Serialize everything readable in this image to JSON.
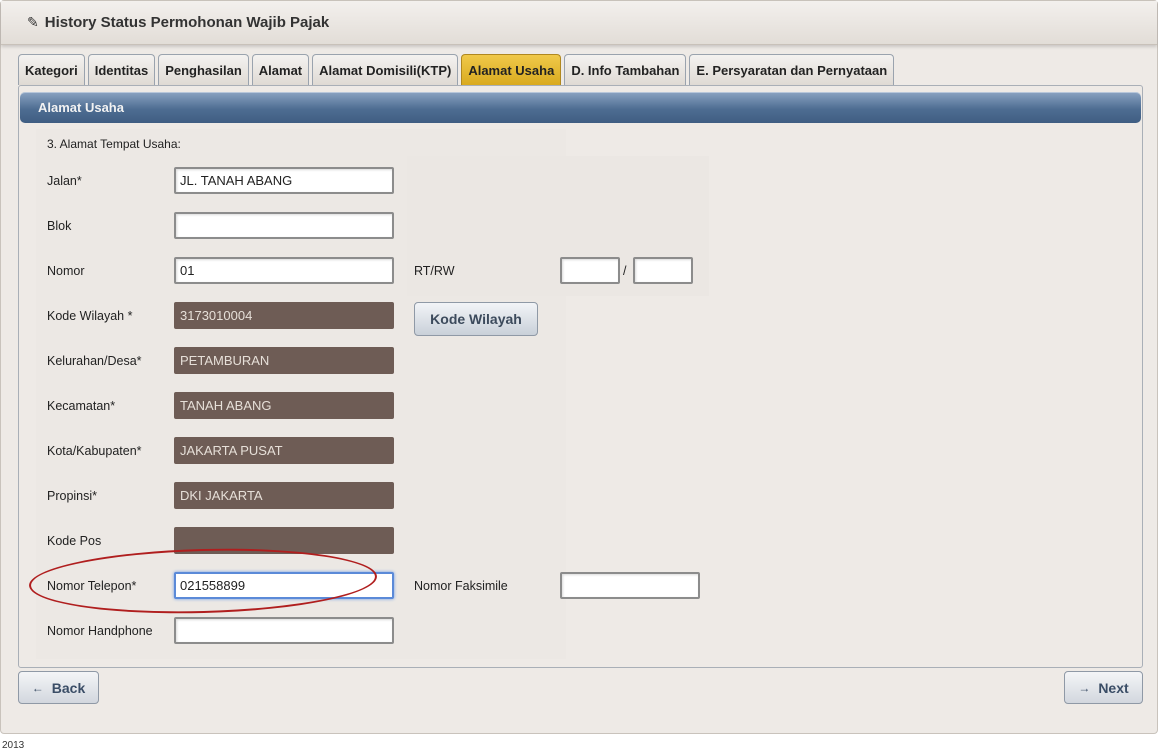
{
  "window": {
    "title": "History Status Permohonan Wajib Pajak",
    "title_icon": "edit-icon"
  },
  "tabs": [
    {
      "label": "Kategori",
      "active": false
    },
    {
      "label": "Identitas",
      "active": false
    },
    {
      "label": "Penghasilan",
      "active": false
    },
    {
      "label": "Alamat",
      "active": false
    },
    {
      "label": "Alamat Domisili(KTP)",
      "active": false
    },
    {
      "label": "Alamat Usaha",
      "active": true
    },
    {
      "label": "D. Info Tambahan",
      "active": false
    },
    {
      "label": "E. Persyaratan dan Pernyataan",
      "active": false
    }
  ],
  "panel": {
    "header": "Alamat Usaha",
    "section_title": "3. Alamat Tempat Usaha:"
  },
  "form": {
    "jalan": {
      "label": "Jalan*",
      "value": "JL. TANAH ABANG"
    },
    "blok": {
      "label": "Blok",
      "value": ""
    },
    "nomor": {
      "label": "Nomor",
      "value": "01"
    },
    "rtrw": {
      "label": "RT/RW",
      "rt": "",
      "rw": "",
      "separator": "/"
    },
    "kode_wilayah": {
      "label": "Kode Wilayah *",
      "value": "3173010004",
      "button": "Kode Wilayah"
    },
    "kelurahan": {
      "label": "Kelurahan/Desa*",
      "value": "PETAMBURAN"
    },
    "kecamatan": {
      "label": "Kecamatan*",
      "value": "TANAH ABANG"
    },
    "kota": {
      "label": "Kota/Kabupaten*",
      "value": "JAKARTA PUSAT"
    },
    "propinsi": {
      "label": "Propinsi*",
      "value": "DKI JAKARTA"
    },
    "kode_pos": {
      "label": "Kode Pos",
      "value": ""
    },
    "telepon": {
      "label": "Nomor Telepon*",
      "value": "021558899"
    },
    "faksimile": {
      "label": "Nomor Faksimile",
      "value": ""
    },
    "handphone": {
      "label": "Nomor Handphone",
      "value": ""
    }
  },
  "nav": {
    "back": "Back",
    "next": "Next",
    "back_icon": "arrow-left-icon",
    "next_icon": "arrow-right-icon"
  },
  "footer": "2013",
  "colors": {
    "active_tab": "#e0b22a",
    "header_bar": "#4e6d92",
    "readonly_field": "#6e5c55",
    "annotation": "#b01e1e"
  }
}
